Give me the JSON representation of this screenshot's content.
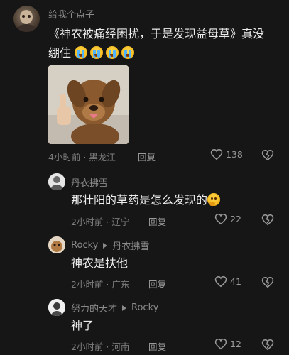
{
  "comments": [
    {
      "username": "给我个点子",
      "text": "《神农被痛经困扰，于是发现益母草》真没绷住",
      "emoji_count": 4,
      "time": "4小时前",
      "location": "黑龙江",
      "reply_label": "回复",
      "likes": "138"
    },
    {
      "username": "丹衣拂雪",
      "text": "那壮阳的草药是怎么发现的",
      "time": "2小时前",
      "location": "辽宁",
      "reply_label": "回复",
      "likes": "22"
    },
    {
      "username": "Rocky",
      "reply_to": "丹衣拂雪",
      "text": "神农是扶他",
      "time": "2小时前",
      "location": "广东",
      "reply_label": "回复",
      "likes": "41"
    },
    {
      "username": "努力的天才",
      "reply_to": "Rocky",
      "text": "神了",
      "time": "2小时前",
      "location": "河南",
      "reply_label": "回复",
      "likes": "12"
    }
  ],
  "icons": {
    "like": "heart-outline-icon",
    "dislike": "broken-heart-icon",
    "reply_arrow": "triangle-right-icon",
    "emoji_cry": "loudly-crying-face-emoji",
    "emoji_think": "thinking-face-emoji"
  },
  "colors": {
    "background": "#161616",
    "text_primary": "#ececec",
    "text_secondary": "#8a8a8a"
  }
}
